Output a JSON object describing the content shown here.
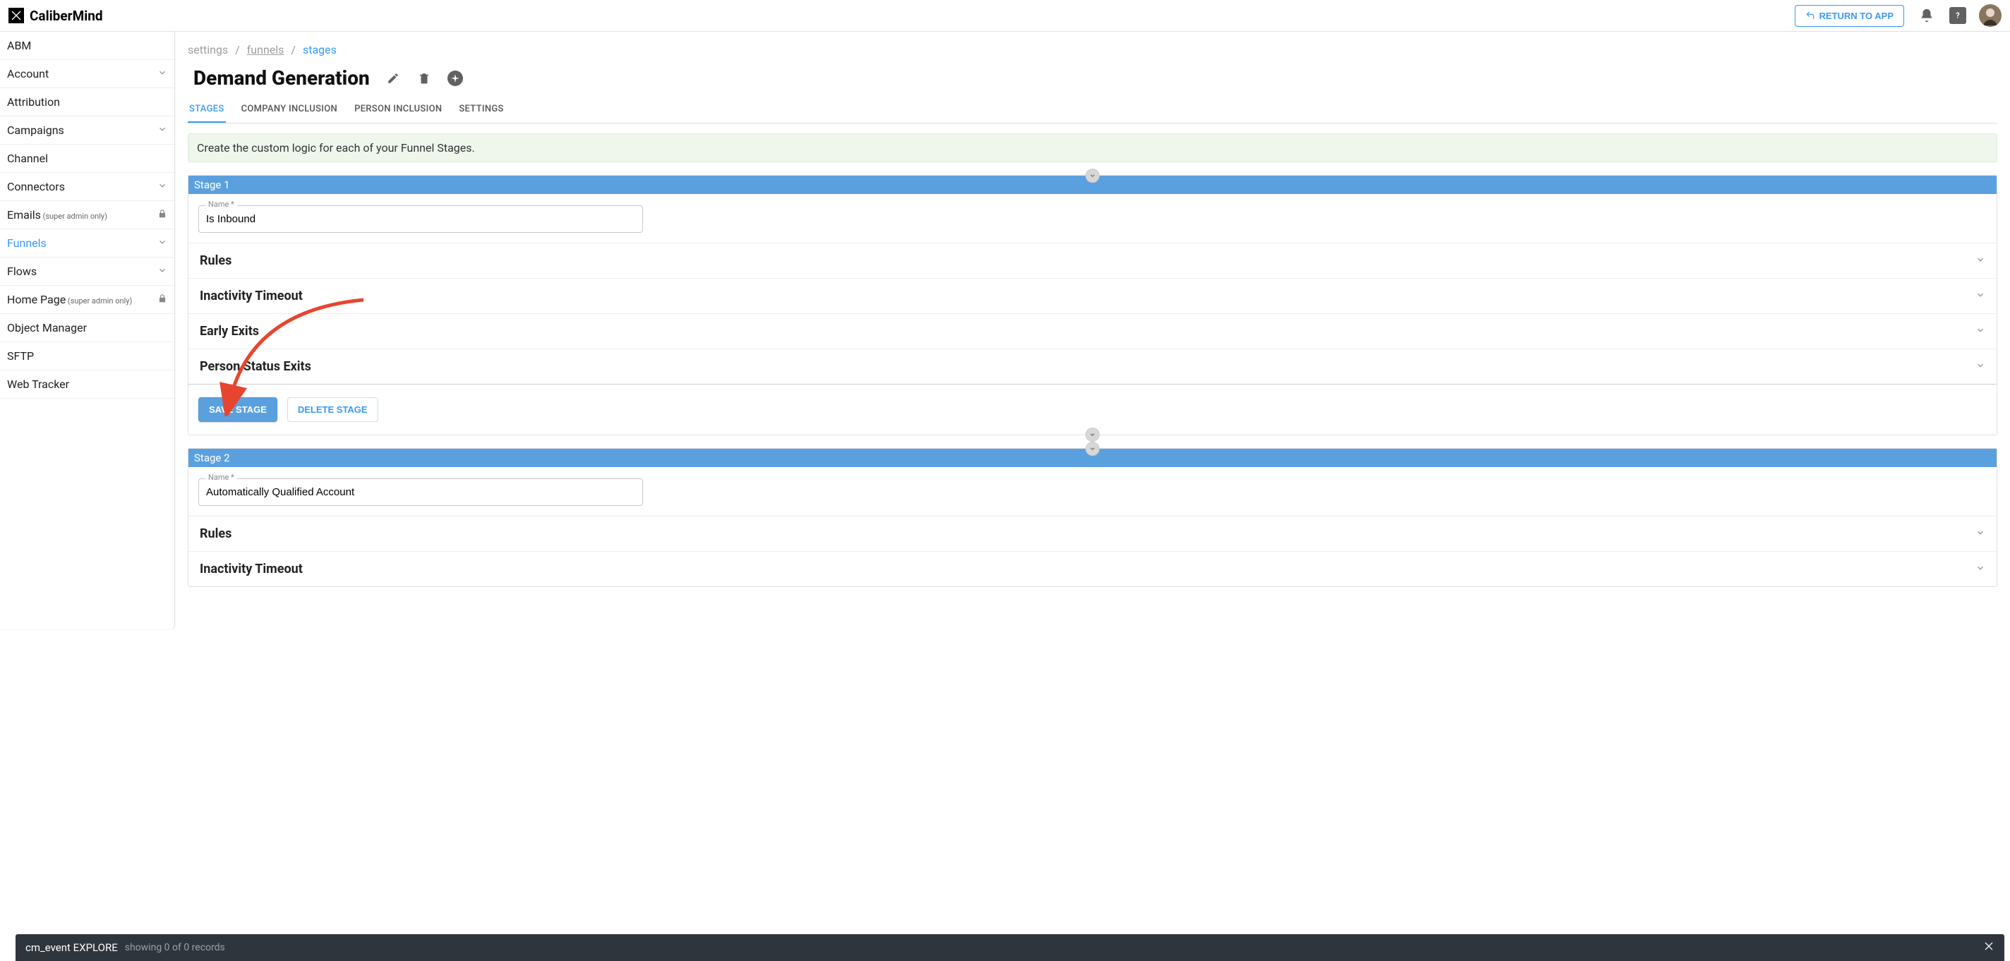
{
  "brand": "CaliberMind",
  "header": {
    "return_label": "RETURN TO APP"
  },
  "sidebar": {
    "items": [
      {
        "label": "ABM",
        "suffix": "",
        "chevron": false,
        "lock": false,
        "active": false
      },
      {
        "label": "Account",
        "suffix": "",
        "chevron": true,
        "lock": false,
        "active": false
      },
      {
        "label": "Attribution",
        "suffix": "",
        "chevron": false,
        "lock": false,
        "active": false
      },
      {
        "label": "Campaigns",
        "suffix": "",
        "chevron": true,
        "lock": false,
        "active": false
      },
      {
        "label": "Channel",
        "suffix": "",
        "chevron": false,
        "lock": false,
        "active": false
      },
      {
        "label": "Connectors",
        "suffix": "",
        "chevron": true,
        "lock": false,
        "active": false
      },
      {
        "label": "Emails",
        "suffix": " (super admin only)",
        "chevron": false,
        "lock": true,
        "active": false
      },
      {
        "label": "Funnels",
        "suffix": "",
        "chevron": true,
        "lock": false,
        "active": true
      },
      {
        "label": "Flows",
        "suffix": "",
        "chevron": true,
        "lock": false,
        "active": false
      },
      {
        "label": "Home Page",
        "suffix": " (super admin only)",
        "chevron": false,
        "lock": true,
        "active": false
      },
      {
        "label": "Object Manager",
        "suffix": "",
        "chevron": false,
        "lock": false,
        "active": false
      },
      {
        "label": "SFTP",
        "suffix": "",
        "chevron": false,
        "lock": false,
        "active": false
      },
      {
        "label": "Web Tracker",
        "suffix": "",
        "chevron": false,
        "lock": false,
        "active": false
      }
    ]
  },
  "breadcrumbs": {
    "root": "settings",
    "parent": "funnels",
    "current": "stages"
  },
  "page": {
    "title": "Demand Generation"
  },
  "tabs": [
    {
      "label": "STAGES",
      "active": true
    },
    {
      "label": "COMPANY INCLUSION",
      "active": false
    },
    {
      "label": "PERSON INCLUSION",
      "active": false
    },
    {
      "label": "SETTINGS",
      "active": false
    }
  ],
  "info_banner": "Create the custom logic for each of your Funnel Stages.",
  "stages": [
    {
      "header": "Stage 1",
      "name_label": "Name *",
      "name_value": "Is Inbound",
      "accordion": [
        {
          "title": "Rules"
        },
        {
          "title": "Inactivity Timeout"
        },
        {
          "title": "Early Exits"
        },
        {
          "title": "Person Status Exits"
        }
      ],
      "save_label": "SAVE STAGE",
      "delete_label": "DELETE STAGE"
    },
    {
      "header": "Stage 2",
      "name_label": "Name *",
      "name_value": "Automatically Qualified Account",
      "accordion": [
        {
          "title": "Rules"
        },
        {
          "title": "Inactivity Timeout"
        }
      ]
    }
  ],
  "bottom_bar": {
    "title": "cm_event EXPLORE",
    "subtitle": "showing 0 of 0 records"
  }
}
